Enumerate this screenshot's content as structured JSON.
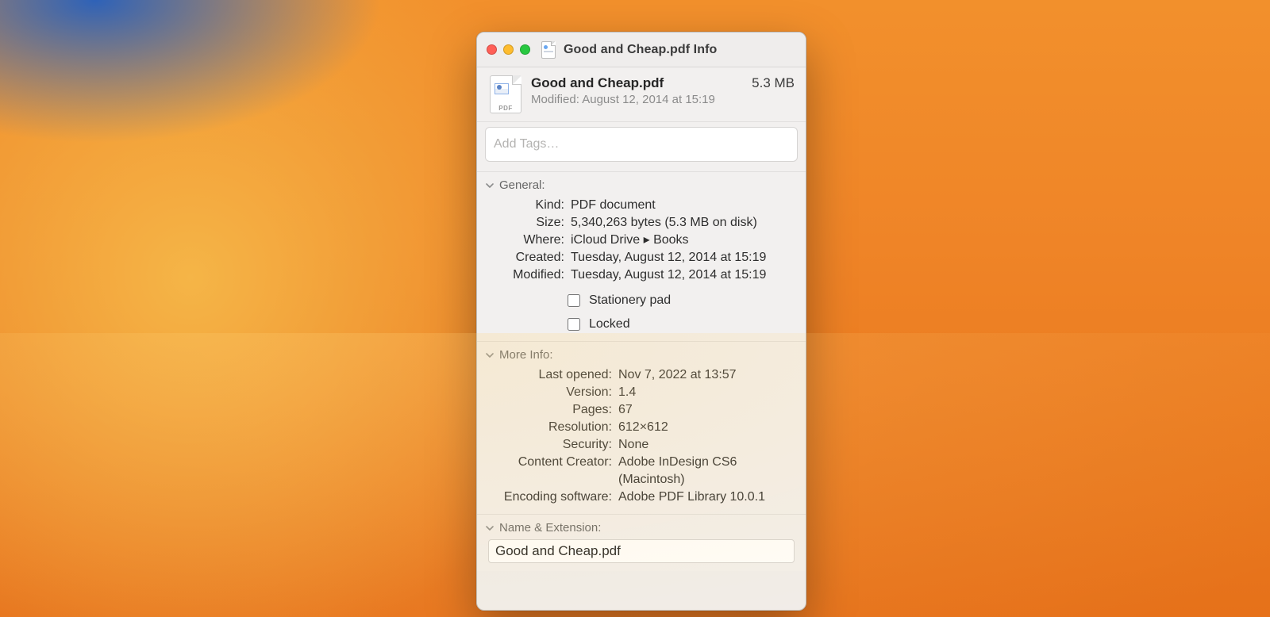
{
  "window": {
    "title": "Good and Cheap.pdf Info"
  },
  "summary": {
    "filename": "Good and Cheap.pdf",
    "size": "5.3 MB",
    "modified_label": "Modified:",
    "modified_value": "August 12, 2014 at 15:19",
    "icon_badge": "PDF"
  },
  "tags": {
    "placeholder": "Add Tags…"
  },
  "sections": {
    "general": {
      "title": "General:",
      "kind_label": "Kind:",
      "kind_value": "PDF document",
      "size_label": "Size:",
      "size_value": "5,340,263 bytes (5.3 MB on disk)",
      "where_label": "Where:",
      "where_value": "iCloud Drive ▸ Books",
      "created_label": "Created:",
      "created_value": "Tuesday, August 12, 2014 at 15:19",
      "modified_label": "Modified:",
      "modified_value": "Tuesday, August 12, 2014 at 15:19",
      "stationery_label": "Stationery pad",
      "locked_label": "Locked"
    },
    "more_info": {
      "title": "More Info:",
      "last_opened_label": "Last opened:",
      "last_opened_value": "Nov 7, 2022 at 13:57",
      "version_label": "Version:",
      "version_value": "1.4",
      "pages_label": "Pages:",
      "pages_value": "67",
      "resolution_label": "Resolution:",
      "resolution_value": "612×612",
      "security_label": "Security:",
      "security_value": "None",
      "content_creator_label": "Content Creator:",
      "content_creator_value": "Adobe InDesign CS6 (Macintosh)",
      "encoding_label": "Encoding software:",
      "encoding_value": "Adobe PDF Library 10.0.1"
    },
    "name_ext": {
      "title": "Name & Extension:",
      "value": "Good and Cheap.pdf"
    }
  }
}
